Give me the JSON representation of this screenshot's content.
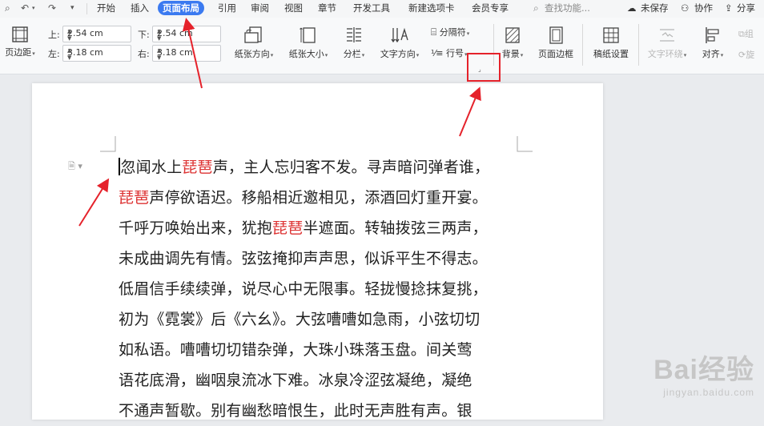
{
  "menubar": {
    "tabs": [
      {
        "label": "开始"
      },
      {
        "label": "插入"
      },
      {
        "label": "页面布局"
      },
      {
        "label": "引用"
      },
      {
        "label": "审阅"
      },
      {
        "label": "视图"
      },
      {
        "label": "章节"
      },
      {
        "label": "开发工具"
      },
      {
        "label": "新建选项卡"
      },
      {
        "label": "会员专享"
      }
    ],
    "active_tab": "页面布局",
    "search_placeholder": "查找功能...",
    "unsaved": "未保存",
    "collab": "协作",
    "share": "分享"
  },
  "ribbon": {
    "margins_label": "页边距",
    "top_label": "上:",
    "top_value": "2.54 cm",
    "bottom_label": "下:",
    "bottom_value": "2.54 cm",
    "left_label": "左:",
    "left_value": "3.18 cm",
    "right_label": "右:",
    "right_value": "3.18 cm",
    "orientation": "纸张方向",
    "size": "纸张大小",
    "columns": "分栏",
    "text_direction": "文字方向",
    "breaks": "分隔符",
    "line_numbers": "行号",
    "background": "背景",
    "page_border": "页面边框",
    "manuscript": "稿纸设置",
    "wrap_text": "文字环绕",
    "align": "对齐",
    "group": "组",
    "rotate": "旋"
  },
  "document": {
    "lines": [
      [
        {
          "t": "忽闻水上"
        },
        {
          "t": "琵琶",
          "red": true
        },
        {
          "t": "声，主人忘归客不发。寻声暗问弹者谁，"
        }
      ],
      [
        {
          "t": "琵琶",
          "red": true
        },
        {
          "t": "声停欲语迟。移船相近邀相见，添酒回灯重开宴。"
        }
      ],
      [
        {
          "t": "千呼万唤始出来，犹抱"
        },
        {
          "t": "琵琶",
          "red": true
        },
        {
          "t": "半遮面。转轴拨弦三两声，"
        }
      ],
      [
        {
          "t": "未成曲调先有情。弦弦掩抑声声思，似诉平生不得志。"
        }
      ],
      [
        {
          "t": "低眉信手续续弹，说尽心中无限事。轻拢慢捻抹复挑，"
        }
      ],
      [
        {
          "t": "初为《霓裳》后《六幺》。大弦嘈嘈如急雨，小弦切切"
        }
      ],
      [
        {
          "t": "如私语。嘈嘈切切错杂弹，大珠小珠落玉盘。间关莺"
        }
      ],
      [
        {
          "t": "语花底滑，幽咽泉流冰下难。冰泉冷涩弦凝绝，凝绝"
        }
      ],
      [
        {
          "t": "不通声暂歇。别有幽愁暗恨生，此时无声胜有声。银"
        }
      ]
    ]
  },
  "watermark": {
    "big": "Bai经验",
    "small": "jingyan.baidu.com"
  },
  "colors": {
    "accent": "#3b7af0",
    "annotation": "#e5222b",
    "highlight_text": "#dd3333"
  }
}
